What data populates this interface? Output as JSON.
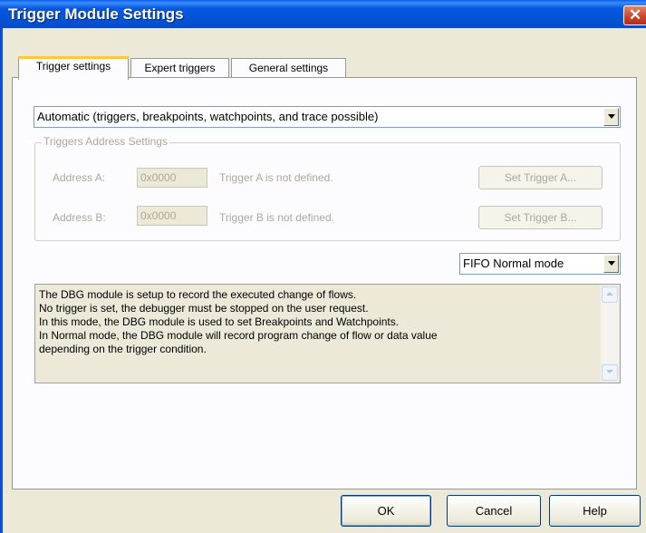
{
  "window": {
    "title": "Trigger Module Settings"
  },
  "tabs": [
    {
      "label": "Trigger settings",
      "active": true
    },
    {
      "label": "Expert triggers",
      "active": false
    },
    {
      "label": "General settings",
      "active": false
    }
  ],
  "mode_select": {
    "value": "Automatic (triggers, breakpoints, watchpoints, and trace possible)"
  },
  "address_group": {
    "legend": "Triggers Address Settings",
    "a": {
      "label": "Address A:",
      "value": "0x0000",
      "status": "Trigger A is not defined.",
      "button": "Set Trigger A..."
    },
    "b": {
      "label": "Address B:",
      "value": "0x0000",
      "status": "Trigger B is not defined.",
      "button": "Set Trigger B..."
    }
  },
  "fifo_select": {
    "value": "FIFO Normal mode"
  },
  "description": {
    "lines": [
      "The DBG module is setup to record the executed change of flows.",
      "No trigger is set, the debugger must be stopped on the user request.",
      "In this mode, the DBG module is used to set Breakpoints and Watchpoints.",
      "In Normal mode, the DBG module will record program change of flow or data value",
      "depending on the trigger condition."
    ]
  },
  "footer": {
    "ok": "OK",
    "cancel": "Cancel",
    "help": "Help"
  },
  "icons": {
    "close": "close-icon",
    "dropdown": "chevron-down-icon"
  },
  "colors": {
    "titlebar": "#0453d6",
    "dialog_bg": "#ece9d8",
    "tab_accent": "#ffc83c",
    "disabled_text": "#aca899"
  }
}
